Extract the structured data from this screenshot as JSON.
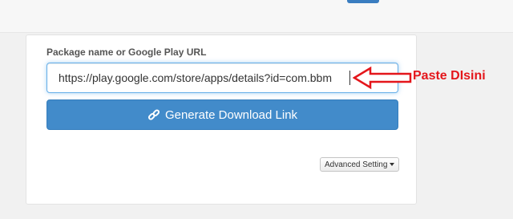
{
  "form": {
    "label": "Package name or Google Play URL",
    "url_value": "https://play.google.com/store/apps/details?id=com.bbm",
    "generate_label": "Generate Download Link",
    "advanced_label": "Advanced Setting"
  },
  "annotation": {
    "text": "Paste DIsini",
    "color": "#e4161b"
  },
  "icons": {
    "generate": "link-icon",
    "advanced": "caret-down-icon",
    "pointer": "arrow-left-icon"
  },
  "colors": {
    "primary_button": "#428bca",
    "input_focus": "#66afe9"
  }
}
